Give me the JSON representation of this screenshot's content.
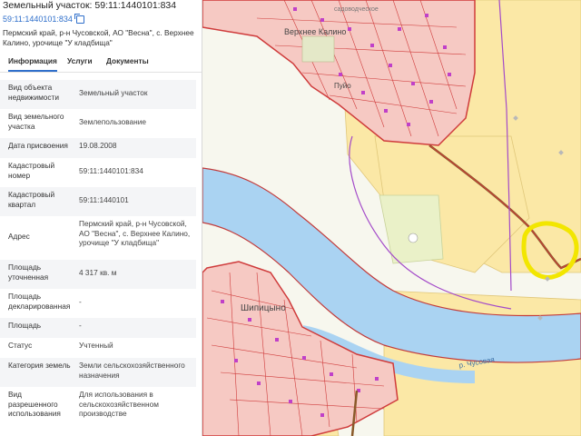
{
  "panel": {
    "title": "Земельный участок: 59:11:1440101:834",
    "cad_number": "59:11:1440101:834",
    "address": "Пермский край, р-н Чусовской, АО \"Весна\", с. Верхнее Калино, урочище \"У кладбища\"",
    "tabs": [
      {
        "label": "Информация",
        "active": true
      },
      {
        "label": "Услуги",
        "active": false
      },
      {
        "label": "Документы",
        "active": false
      }
    ],
    "rows": [
      {
        "key": "Вид объекта недвижимости",
        "value": "Земельный участок"
      },
      {
        "key": "Вид земельного участка",
        "value": "Землепользование"
      },
      {
        "key": "Дата присвоения",
        "value": "19.08.2008"
      },
      {
        "key": "Кадастровый номер",
        "value": "59:11:1440101:834"
      },
      {
        "key": "Кадастровый квартал",
        "value": "59:11:1440101"
      },
      {
        "key": "Адрес",
        "value": "Пермский край, р-н Чусовской, АО \"Весна\", с. Верхнее Калино, урочище \"У кладбища\""
      },
      {
        "key": "Площадь уточненная",
        "value": "4 317 кв. м"
      },
      {
        "key": "Площадь декларированная",
        "value": "-"
      },
      {
        "key": "Площадь",
        "value": "-"
      },
      {
        "key": "Статус",
        "value": "Учтенный"
      },
      {
        "key": "Категория земель",
        "value": "Земли сельскохозяйственного назначения"
      },
      {
        "key": "Вид разрешенного использования",
        "value": "Для использования в сельскохозяйственном производстве"
      }
    ]
  },
  "map": {
    "labels": {
      "village_top": "Верхнее Калино",
      "village_top_small": "Пуйо",
      "village_bottom": "Шипицыно",
      "river": "р. Чусовая",
      "top_note": "садоводческое"
    },
    "colors": {
      "water": "#aad3f2",
      "parcel_fill": "#fbe8a6",
      "settlement_fill": "#f6c9c3",
      "boundary_red": "#cf3b3b",
      "boundary_purple": "#a34ac9",
      "highlight": "#f2e600",
      "building": "#c040c8"
    }
  }
}
